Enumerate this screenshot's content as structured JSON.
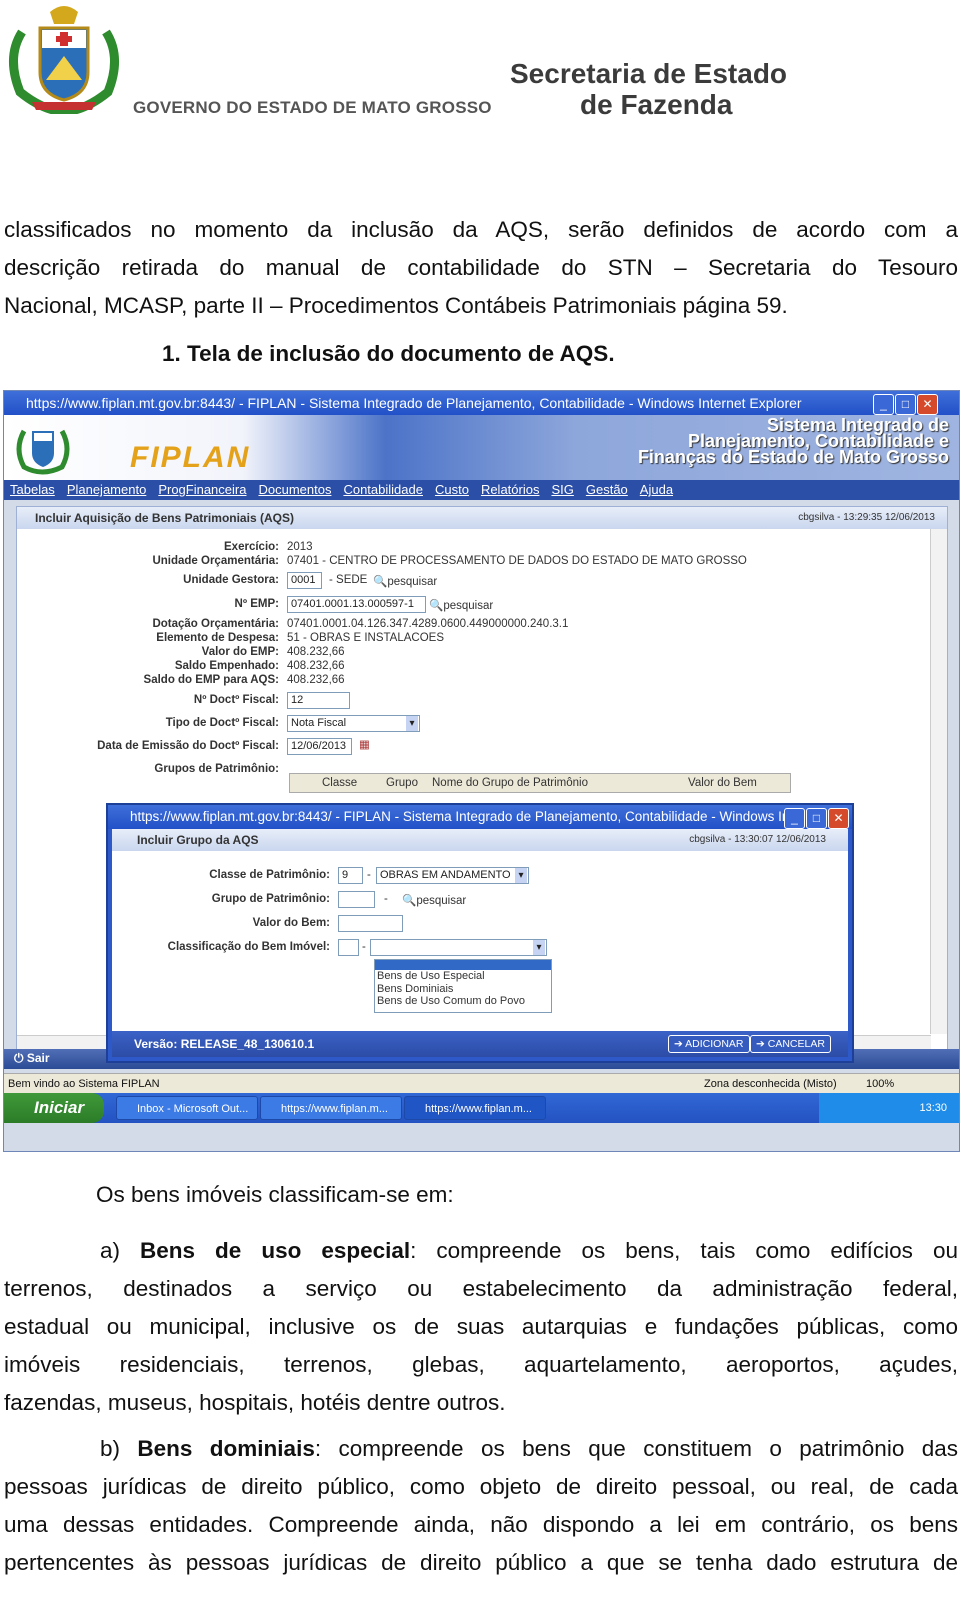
{
  "header": {
    "government": "GOVERNO DO ESTADO DE MATO GROSSO",
    "secretariat_line1": "Secretaria de Estado",
    "secretariat_line2": "de Fazenda"
  },
  "text": {
    "p1_l1": "classificados no momento da inclusão da AQS, serão definidos de acordo com a",
    "p1_l2": "descrição retirada do manual de contabilidade do STN – Secretaria do Tesouro",
    "p1_l3": "Nacional, MCASP, parte II – Procedimentos Contábeis Patrimoniais página 59.",
    "caption": "1.  Tela de inclusão do documento de AQS.",
    "intro": "Os bens imóveis classificam-se em:",
    "a_prefix": "a)",
    "a_term": "Bens de uso especial",
    "a_l1_rest": ": compreende os bens, tais como edifícios ou",
    "a_l2": "terrenos, destinados a serviço ou estabelecimento da administração federal,",
    "a_l3": "estadual  ou municipal,  inclusive os de suas autarquias e fundações públicas, como",
    "a_l4": "imóveis residenciais, terrenos, glebas, aquartelamento, aeroportos, açudes,",
    "a_l5": "fazendas, museus, hospitais, hotéis dentre outros.",
    "b_prefix": "b)",
    "b_term": "Bens dominiais",
    "b_l1_rest": ": compreende os bens que constituem o patrimônio das",
    "b_l2": "pessoas jurídicas de direito público, como objeto de direito pessoal, ou real, de cada",
    "b_l3": "uma dessas entidades. Compreende ainda, não dispondo a lei em contrário, os bens",
    "b_l4": "pertencentes às pessoas jurídicas de direito público a que se tenha dado estrutura de"
  },
  "screenshot": {
    "window_title": "https://www.fiplan.mt.gov.br:8443/ - FIPLAN - Sistema Integrado de Planejamento, Contabilidade - Windows Internet Explorer",
    "logo": "FIPLAN",
    "banner_l1": "Sistema Integrado de",
    "banner_l2": "Planejamento, Contabilidade e",
    "banner_l3": "Finanças do Estado de Mato Grosso",
    "menu": [
      "Tabelas",
      "Planejamento",
      "ProgFinanceira",
      "Documentos",
      "Contabilidade",
      "Custo",
      "Relatórios",
      "SIG",
      "Gestão",
      "Ajuda"
    ],
    "panel_title": "Incluir Aquisição de Bens Patrimoniais (AQS)",
    "panel_user": "cbgsilva - 13:29:35 12/06/2013",
    "fields": {
      "exercicio_label": "Exercício:",
      "exercicio": "2013",
      "uo_label": "Unidade Orçamentária:",
      "uo": "07401  -  CENTRO DE PROCESSAMENTO DE DADOS DO ESTADO DE MATO GROSSO",
      "ug_label": "Unidade Gestora:",
      "ug_code": "0001",
      "ug_name": "-  SEDE",
      "search": "pesquisar",
      "emp_label": "Nº EMP:",
      "emp": "07401.0001.13.000597-1",
      "dot_label": "Dotação Orçamentária:",
      "dot": "07401.0001.04.126.347.4289.0600.449000000.240.3.1",
      "elem_label": "Elemento de Despesa:",
      "elem": "51  -  OBRAS E INSTALACOES",
      "valor_emp_label": "Valor do EMP:",
      "valor_emp": "408.232,66",
      "saldo_emp_label": "Saldo Empenhado:",
      "saldo_emp": "408.232,66",
      "saldo_aqs_label": "Saldo do EMP para AQS:",
      "saldo_aqs": "408.232,66",
      "doc_num_label": "Nº Doctº Fiscal:",
      "doc_num": "12",
      "doc_tipo_label": "Tipo de Doctº Fiscal:",
      "doc_tipo": "Nota Fiscal",
      "doc_data_label": "Data de Emissão do Doctº Fiscal:",
      "doc_data": "12/06/2013",
      "grupos_label": "Grupos de Patrimônio:"
    },
    "grid_headers": [
      "Classe",
      "Grupo",
      "Nome do Grupo de Patrimônio",
      "Valor do Bem"
    ],
    "sair": "Sair",
    "status_left": "Bem vindo ao Sistema FIPLAN",
    "status_zone": "Zona desconhecida (Misto)",
    "zoom": "100%",
    "start": "Iniciar",
    "tasks": [
      "Inbox - Microsoft Out...",
      "https://www.fiplan.m...",
      "https://www.fiplan.m..."
    ],
    "clock": "13:30"
  },
  "popup": {
    "title": "https://www.fiplan.mt.gov.br:8443/ - FIPLAN - Sistema Integrado de Planejamento, Contabilidade - Windows Int...",
    "head": "Incluir Grupo da AQS",
    "user": "cbgsilva - 13:30:07 12/06/2013",
    "classe_label": "Classe de Patrimônio:",
    "classe_code": "9",
    "classe_value": "OBRAS EM ANDAMENTO",
    "grupo_label": "Grupo de Patrimônio:",
    "search": "pesquisar",
    "valor_label": "Valor do Bem:",
    "classif_label": "Classificação do Bem Imóvel:",
    "options": [
      "Bens de Uso Especial",
      "Bens Dominiais",
      "Bens de Uso Comum do Povo"
    ],
    "version": "Versão: RELEASE_48_130610.1",
    "add": "ADICIONAR",
    "cancel": "CANCELAR"
  }
}
